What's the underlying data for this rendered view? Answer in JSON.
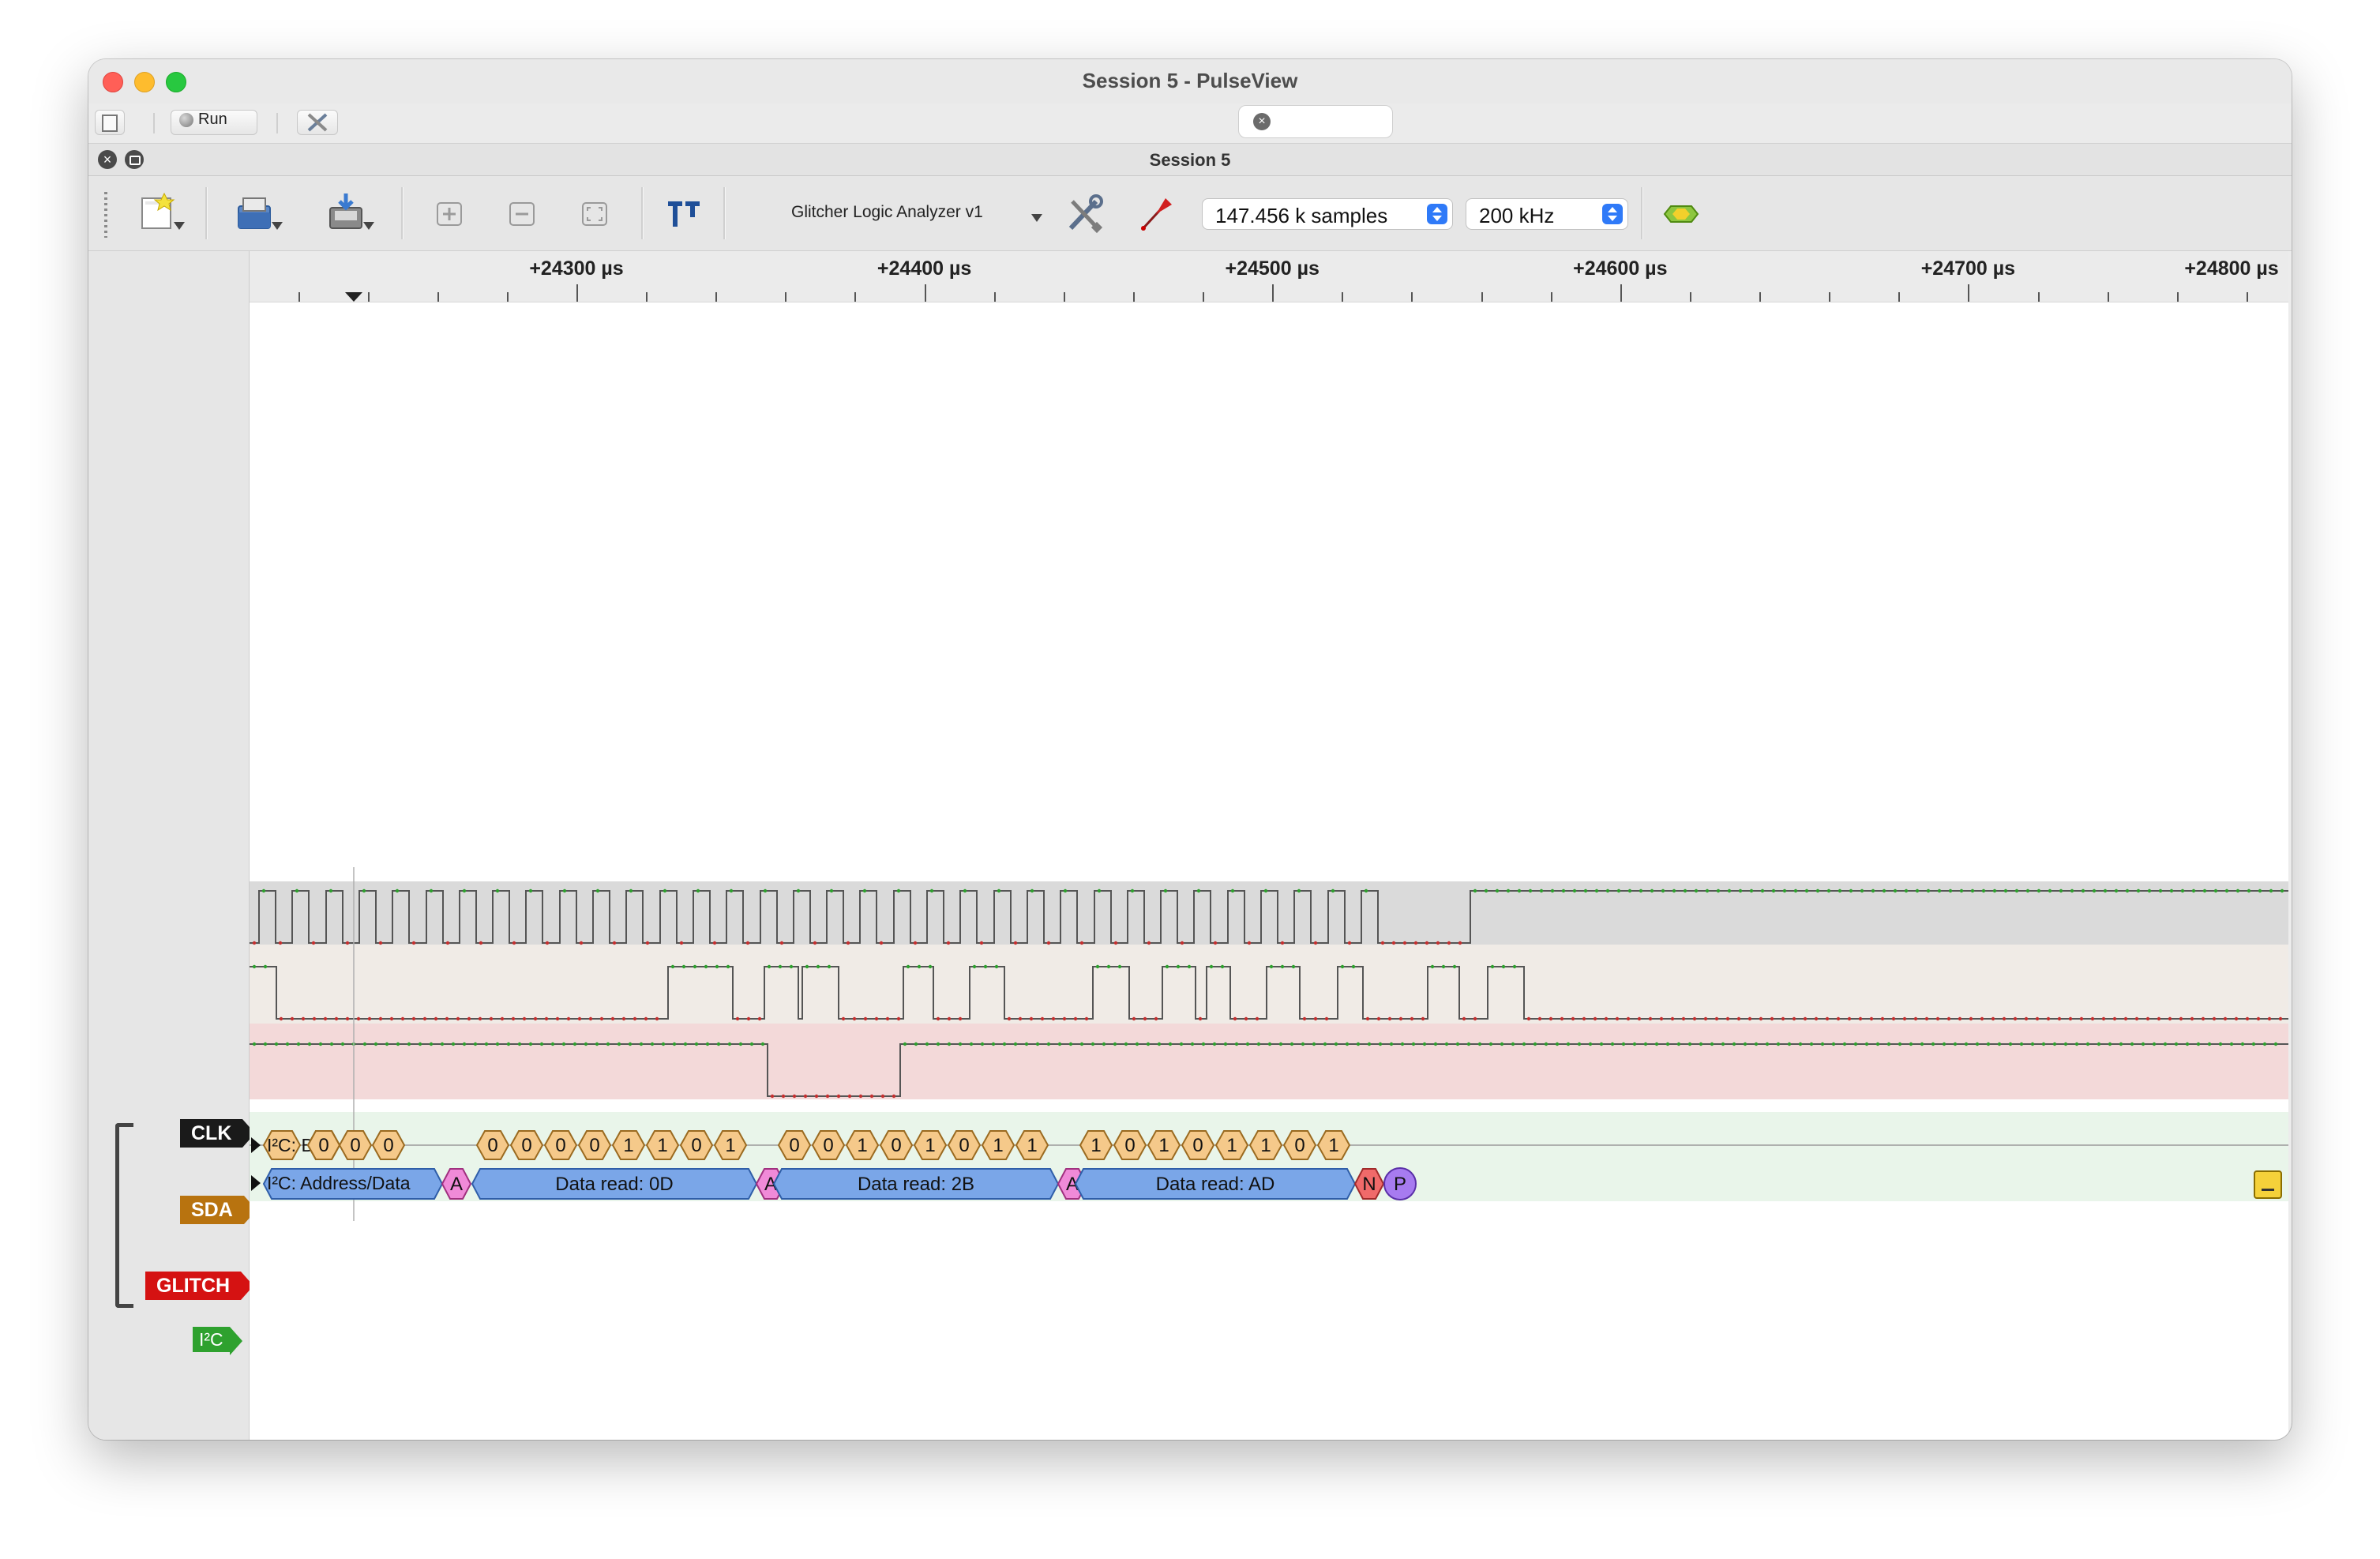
{
  "window": {
    "title": "Session 5 - PulseView"
  },
  "main_toolbar": {
    "run_label": "Run"
  },
  "session": {
    "title": "Session 5"
  },
  "toolbar": {
    "device": "Glitcher Logic Analyzer v1",
    "samples": "147.456 k samples",
    "samplerate": "200 kHz"
  },
  "ruler": {
    "labels": [
      "+24300 µs",
      "+24400 µs",
      "+24500 µs",
      "+24600 µs",
      "+24700 µs",
      "+24800 µs"
    ]
  },
  "channels": {
    "clk": {
      "name": "CLK",
      "color": "#1a1a1a"
    },
    "sda": {
      "name": "SDA",
      "color": "#b8730f"
    },
    "glitch": {
      "name": "GLITCH",
      "color": "#d51212"
    }
  },
  "decoder": {
    "name": "I²C",
    "color": "#2ea12e",
    "bits_row_label": "I²C: Bits",
    "addr_row_label": "I²C: Address/Data",
    "bits_first": [
      "0",
      "0",
      "0"
    ],
    "bytes": [
      {
        "bits": [
          "0",
          "0",
          "0",
          "0",
          "1",
          "1",
          "0",
          "1"
        ],
        "label": "Data read: 0D",
        "ack": "A"
      },
      {
        "bits": [
          "0",
          "0",
          "1",
          "0",
          "1",
          "0",
          "1",
          "1"
        ],
        "label": "Data read: 2B",
        "ack": "A"
      },
      {
        "bits": [
          "1",
          "0",
          "1",
          "0",
          "1",
          "1",
          "0",
          "1"
        ],
        "label": "Data read: AD",
        "ack": "N"
      }
    ],
    "first_ack": "A",
    "stop": "P"
  }
}
